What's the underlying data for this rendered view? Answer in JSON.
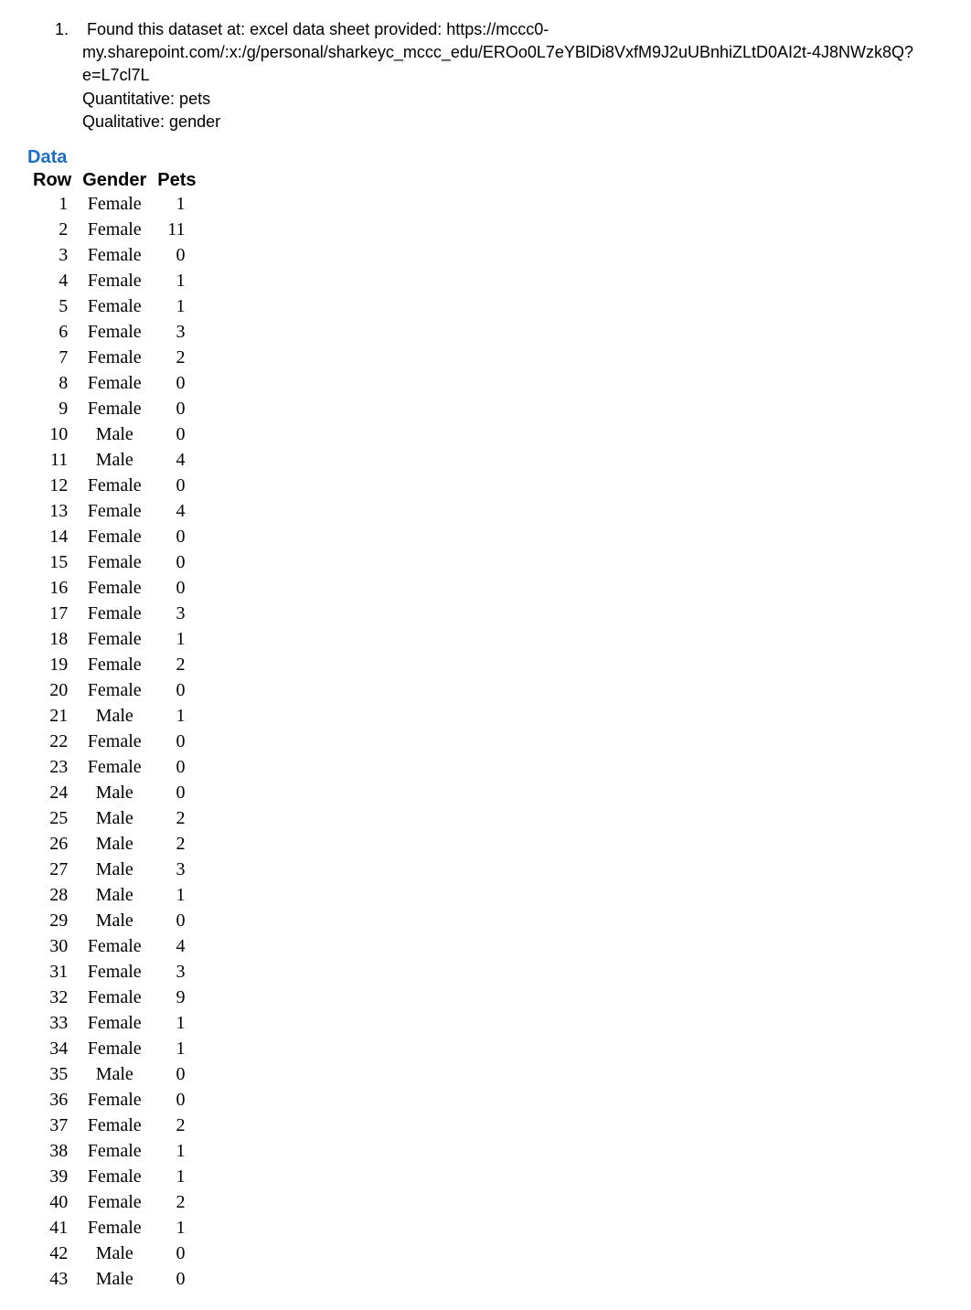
{
  "list": {
    "number": "1.",
    "line1": "Found this dataset at: excel data sheet provided: https://mccc0-",
    "line2": "my.sharepoint.com/:x:/g/personal/sharkeyc_mccc_edu/EROo0L7eYBlDi8VxfM9J2uUBnhiZLtD0AI2t-4J8NWzk8Q?e=L7cl7L",
    "line3": "Quantitative: pets",
    "line4": "Qualitative: gender"
  },
  "section_title": "Data",
  "table": {
    "headers": {
      "row": "Row",
      "gender": "Gender",
      "pets": "Pets"
    },
    "rows": [
      {
        "row": "1",
        "gender": "Female",
        "pets": "1"
      },
      {
        "row": "2",
        "gender": "Female",
        "pets": "11"
      },
      {
        "row": "3",
        "gender": "Female",
        "pets": "0"
      },
      {
        "row": "4",
        "gender": "Female",
        "pets": "1"
      },
      {
        "row": "5",
        "gender": "Female",
        "pets": "1"
      },
      {
        "row": "6",
        "gender": "Female",
        "pets": "3"
      },
      {
        "row": "7",
        "gender": "Female",
        "pets": "2"
      },
      {
        "row": "8",
        "gender": "Female",
        "pets": "0"
      },
      {
        "row": "9",
        "gender": "Female",
        "pets": "0"
      },
      {
        "row": "10",
        "gender": "Male",
        "pets": "0"
      },
      {
        "row": "11",
        "gender": "Male",
        "pets": "4"
      },
      {
        "row": "12",
        "gender": "Female",
        "pets": "0"
      },
      {
        "row": "13",
        "gender": "Female",
        "pets": "4"
      },
      {
        "row": "14",
        "gender": "Female",
        "pets": "0"
      },
      {
        "row": "15",
        "gender": "Female",
        "pets": "0"
      },
      {
        "row": "16",
        "gender": "Female",
        "pets": "0"
      },
      {
        "row": "17",
        "gender": "Female",
        "pets": "3"
      },
      {
        "row": "18",
        "gender": "Female",
        "pets": "1"
      },
      {
        "row": "19",
        "gender": "Female",
        "pets": "2"
      },
      {
        "row": "20",
        "gender": "Female",
        "pets": "0"
      },
      {
        "row": "21",
        "gender": "Male",
        "pets": "1"
      },
      {
        "row": "22",
        "gender": "Female",
        "pets": "0"
      },
      {
        "row": "23",
        "gender": "Female",
        "pets": "0"
      },
      {
        "row": "24",
        "gender": "Male",
        "pets": "0"
      },
      {
        "row": "25",
        "gender": "Male",
        "pets": "2"
      },
      {
        "row": "26",
        "gender": "Male",
        "pets": "2"
      },
      {
        "row": "27",
        "gender": "Male",
        "pets": "3"
      },
      {
        "row": "28",
        "gender": "Male",
        "pets": "1"
      },
      {
        "row": "29",
        "gender": "Male",
        "pets": "0"
      },
      {
        "row": "30",
        "gender": "Female",
        "pets": "4"
      },
      {
        "row": "31",
        "gender": "Female",
        "pets": "3"
      },
      {
        "row": "32",
        "gender": "Female",
        "pets": "9"
      },
      {
        "row": "33",
        "gender": "Female",
        "pets": "1"
      },
      {
        "row": "34",
        "gender": "Female",
        "pets": "1"
      },
      {
        "row": "35",
        "gender": "Male",
        "pets": "0"
      },
      {
        "row": "36",
        "gender": "Female",
        "pets": "0"
      },
      {
        "row": "37",
        "gender": "Female",
        "pets": "2"
      },
      {
        "row": "38",
        "gender": "Female",
        "pets": "1"
      },
      {
        "row": "39",
        "gender": "Female",
        "pets": "1"
      },
      {
        "row": "40",
        "gender": "Female",
        "pets": "2"
      },
      {
        "row": "41",
        "gender": "Female",
        "pets": "1"
      },
      {
        "row": "42",
        "gender": "Male",
        "pets": "0"
      },
      {
        "row": "43",
        "gender": "Male",
        "pets": "0"
      }
    ]
  }
}
